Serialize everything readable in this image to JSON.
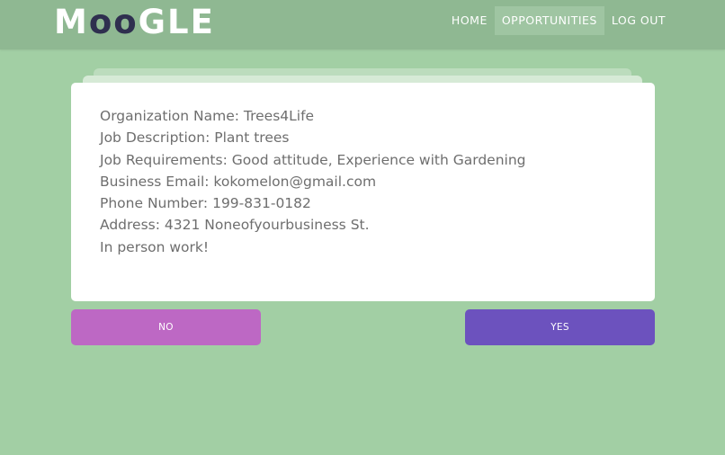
{
  "brand": {
    "logo_part1": "M",
    "logo_part2": "oo",
    "logo_part3": "GLE"
  },
  "nav": {
    "items": [
      {
        "label": "HOME",
        "active": false
      },
      {
        "label": "OPPORTUNITIES",
        "active": true
      },
      {
        "label": "LOG OUT",
        "active": false
      }
    ]
  },
  "card": {
    "lines": [
      "Organization Name: Trees4Life",
      "Job Description: Plant trees",
      "Job Requirements: Good attitude, Experience with Gardening",
      "Business Email: kokomelon@gmail.com",
      "Phone Number: 199-831-0182",
      "Address: 4321 Noneofyourbusiness St.",
      "In person work!"
    ]
  },
  "actions": {
    "no_label": "NO",
    "yes_label": "YES"
  },
  "colors": {
    "background": "#a2cfa4",
    "navbar": "#8fb892",
    "no_button": "#bd68c4",
    "yes_button": "#6c52be",
    "logo_accent": "#2f2f4f"
  }
}
